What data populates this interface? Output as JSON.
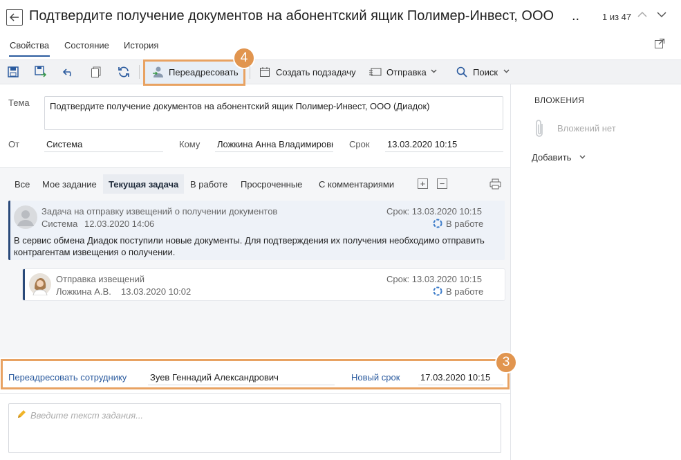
{
  "header": {
    "title": "Подтвердите получение документов на абонентский ящик Полимер-Инвест, ООО",
    "title_ellipsis": "..",
    "counter": "1 из 47"
  },
  "tabs": [
    {
      "label": "Свойства",
      "active": true
    },
    {
      "label": "Состояние",
      "active": false
    },
    {
      "label": "История",
      "active": false
    }
  ],
  "toolbar": {
    "redirect_label": "Переадресовать",
    "subtask_label": "Создать подзадачу",
    "send_label": "Отправка",
    "search_label": "Поиск"
  },
  "callouts": {
    "redirect": "4",
    "row": "3"
  },
  "form": {
    "subject_label": "Тема",
    "subject_value": "Подтвердите получение документов на абонентский ящик Полимер-Инвест, ООО (Диадок)",
    "from_label": "От",
    "from_value": "Система",
    "to_label": "Кому",
    "to_value": "Ложкина Анна Владимировна",
    "due_label": "Срок",
    "due_value": "13.03.2020 10:15"
  },
  "attachments": {
    "title": "ВЛОЖЕНИЯ",
    "empty": "Вложений нет",
    "add_label": "Добавить"
  },
  "filters": [
    "Все",
    "Мое задание",
    "Текущая задача",
    "В работе",
    "Просроченные",
    "С комментариями"
  ],
  "tasks": [
    {
      "title": "Задача на отправку извещений о получении документов",
      "author": "Система",
      "date": "12.03.2020 14:06",
      "due": "Срок: 13.03.2020 10:15",
      "status": "В работе",
      "body": "В сервис обмена Диадок поступили новые документы. Для подтверждения их получения необходимо отправить контрагентам извещения о получении."
    },
    {
      "title": "Отправка извещений",
      "author": "Ложкина А.В.",
      "date": "13.03.2020 10:02",
      "due": "Срок: 13.03.2020 10:15",
      "status": "В работе"
    }
  ],
  "redirect_row": {
    "label": "Переадресовать сотруднику",
    "employee": "Зуев Геннадий Александрович",
    "new_due_label": "Новый срок",
    "new_due_value": "17.03.2020 10:15"
  },
  "task_input": {
    "placeholder": "Введите текст задания..."
  },
  "colors": {
    "accent": "#2a5a9e",
    "highlight": "#e8a262",
    "card_border": "#2a4a7a"
  }
}
